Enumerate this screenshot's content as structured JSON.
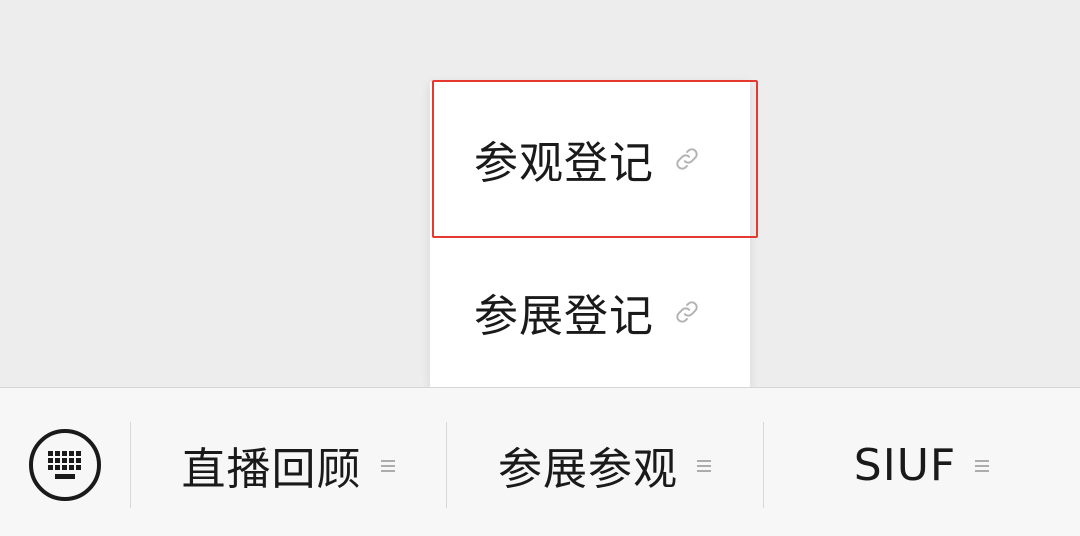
{
  "popup": {
    "items": [
      {
        "label": "参观登记",
        "icon": "link-icon"
      },
      {
        "label": "参展登记",
        "icon": "link-icon"
      }
    ],
    "highlight_color": "#e5382f"
  },
  "menubar": {
    "keyboard_icon": "keyboard-icon",
    "items": [
      {
        "label": "直播回顾",
        "icon": "hamburger-icon"
      },
      {
        "label": "参展参观",
        "icon": "hamburger-icon"
      },
      {
        "label": "SIUF",
        "icon": "hamburger-icon"
      }
    ]
  }
}
